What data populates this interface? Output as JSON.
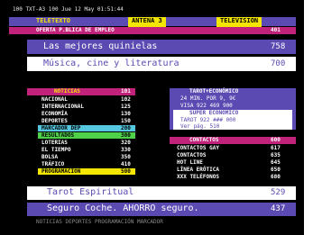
{
  "status_line": "100    TXT-A3  100  Jue  12  May  01:51:44",
  "header": {
    "tabs": [
      "TELETEXTO",
      "ANTENA 3",
      "TELEVISION"
    ],
    "colors": {
      "tab1": "#f4e600",
      "tab2": "#c2237a",
      "tab3": "#c2237a"
    },
    "subtitle_left": "OFERTA P.BLICA DE EMPLEO",
    "subtitle_right": "401"
  },
  "banners": [
    {
      "label": "Las mejores quinielas",
      "page": "758",
      "bg": "#5b4ab2",
      "fg": "#ffffff"
    },
    {
      "label": "Música, cine y literatura",
      "page": "700",
      "bg": "#ffffff",
      "fg": "#5b4ab2"
    }
  ],
  "left_menu": {
    "title": "NOTICIAS",
    "title_page": "101",
    "items": [
      {
        "label": "NACIONAL",
        "page": "102"
      },
      {
        "label": "INTERNACIONAL",
        "page": "125"
      },
      {
        "label": "ECONOMÍA",
        "page": "130"
      },
      {
        "label": "DEPORTES",
        "page": "150"
      },
      {
        "label": "MARCADOR DEP",
        "page": "200",
        "color": "#55c7e0"
      },
      {
        "label": "RESULTADOS",
        "page": "300",
        "color": "#4fd14a"
      },
      {
        "label": "LOTERIAS",
        "page": "320"
      },
      {
        "label": "EL TIEMPO",
        "page": "330"
      },
      {
        "label": "BOLSA",
        "page": "350"
      },
      {
        "label": "TRÁFICO",
        "page": "410"
      },
      {
        "label": "PROGRAMACIÓN",
        "page": "500",
        "color": "#f4e600"
      }
    ]
  },
  "right_panel": {
    "box_title": "TAROT+ECONÓMICO",
    "box_lines": [
      "24 MIN. POR 9, 9€",
      "VISA 922 469 900"
    ],
    "box2_title": "SUPER ECONÓMICO",
    "box2_lines": [
      "TAROT 922 ### 000"
    ],
    "box2_extra": "Ver pág.   510",
    "contact_title": "CONTACTOS",
    "contact_page": "600",
    "items": [
      {
        "label": "CONTACTOS GAY",
        "page": "617"
      },
      {
        "label": "CONTACTOS",
        "page": "635"
      },
      {
        "label": "HOT LINE",
        "page": "645"
      },
      {
        "label": "LÍNEA ERÓTICA",
        "page": "650"
      },
      {
        "label": "XXX TELÉFONOS",
        "page": "680"
      }
    ]
  },
  "bottom_banners": [
    {
      "label": "Tarot Espiritual",
      "page": "529",
      "bg": "#ffffff",
      "fg": "#5b4ab2"
    },
    {
      "label": "Seguro Coche. AHORRO seguro.",
      "page": "437",
      "bg": "#5b4ab2",
      "fg": "#ffffff"
    }
  ],
  "footer": "NOTICIAS  DEPORTES  PROGRAMACIÓN  MARCADOR"
}
